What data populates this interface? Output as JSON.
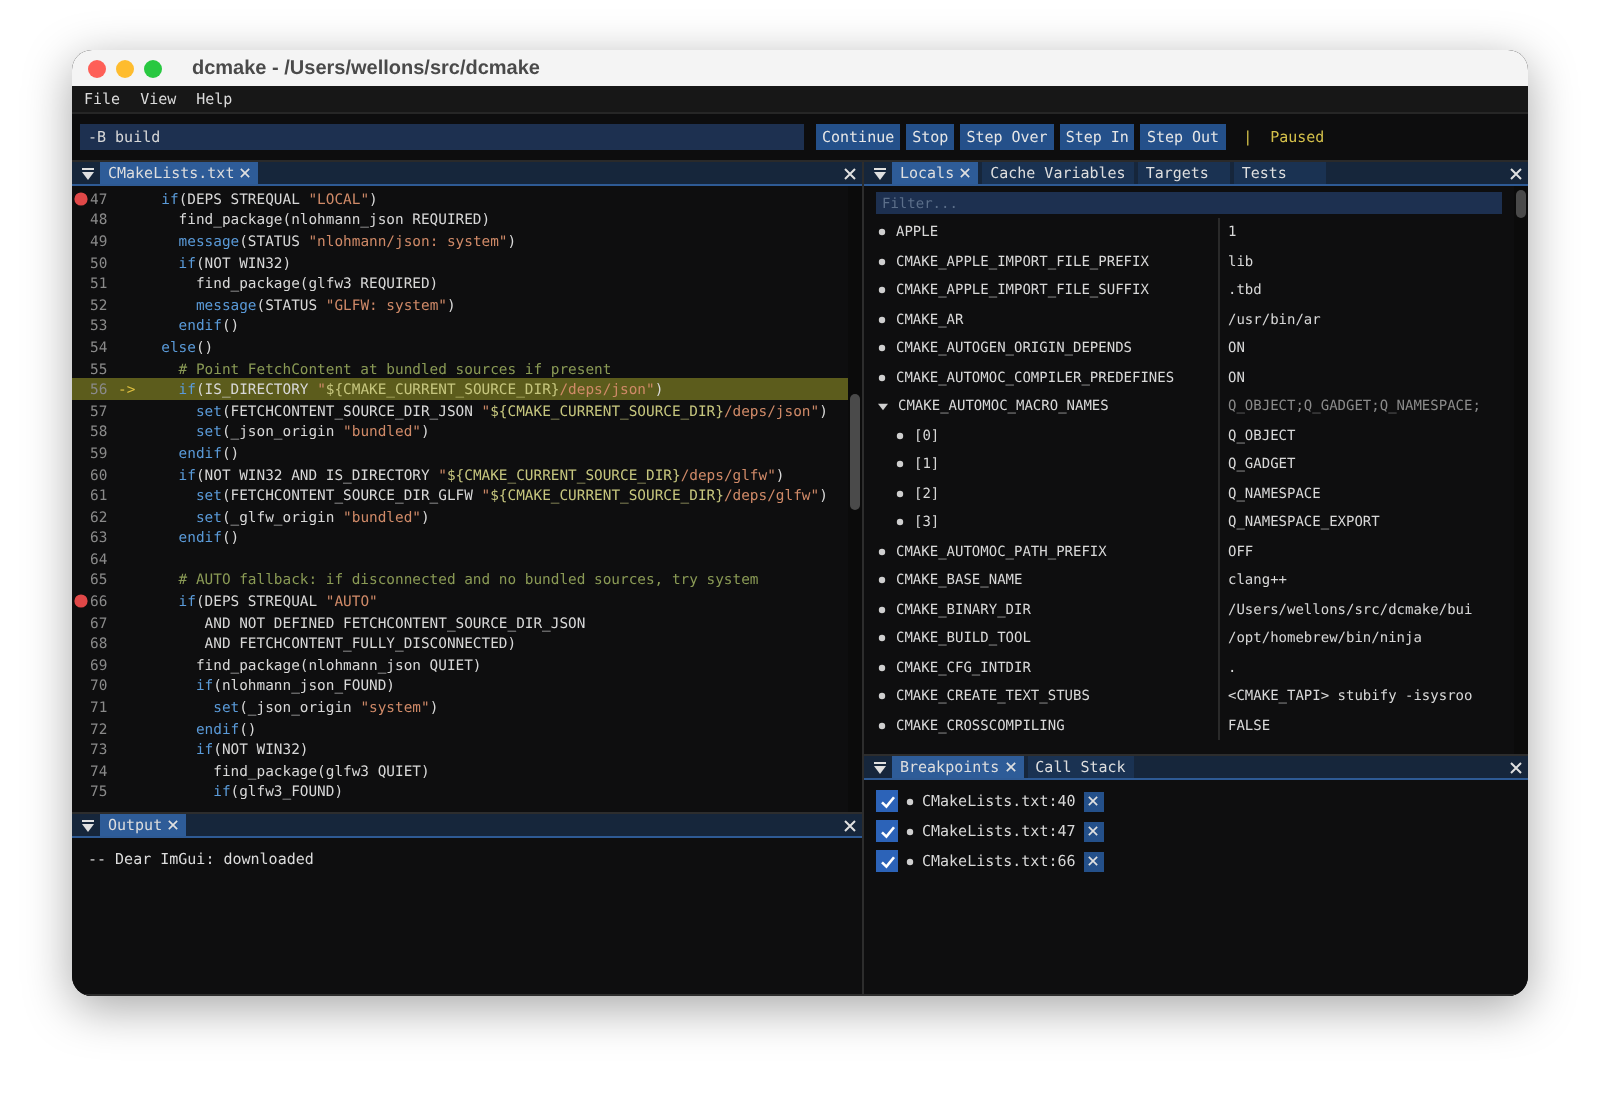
{
  "window": {
    "title": "dcmake - /Users/wellons/src/dcmake"
  },
  "menu": [
    "File",
    "View",
    "Help"
  ],
  "toolbar": {
    "args": "-B build",
    "buttons": [
      "Continue",
      "Stop",
      "Step Over",
      "Step In",
      "Step Out"
    ],
    "separator": "|",
    "status": "Paused"
  },
  "editor": {
    "tabs": [
      {
        "label": "CMakeLists.txt",
        "selected": true
      }
    ],
    "lines": [
      {
        "number": "47",
        "breakpoint": true,
        "current": false,
        "tokens": [
          {
            "kind": "kw",
            "text": "  if"
          },
          {
            "kind": "plain",
            "text": "(DEPS STREQUAL "
          },
          {
            "kind": "str",
            "text": "\"LOCAL\""
          },
          {
            "kind": "plain",
            "text": ")"
          }
        ]
      },
      {
        "number": "48",
        "breakpoint": false,
        "current": false,
        "tokens": [
          {
            "kind": "plain",
            "text": "    find_package(nlohmann_json REQUIRED)"
          }
        ]
      },
      {
        "number": "49",
        "breakpoint": false,
        "current": false,
        "tokens": [
          {
            "kind": "kw",
            "text": "    message"
          },
          {
            "kind": "plain",
            "text": "(STATUS "
          },
          {
            "kind": "str",
            "text": "\"nlohmann/json: system\""
          },
          {
            "kind": "plain",
            "text": ")"
          }
        ]
      },
      {
        "number": "50",
        "breakpoint": false,
        "current": false,
        "tokens": [
          {
            "kind": "kw",
            "text": "    if"
          },
          {
            "kind": "plain",
            "text": "(NOT WIN32)"
          }
        ]
      },
      {
        "number": "51",
        "breakpoint": false,
        "current": false,
        "tokens": [
          {
            "kind": "plain",
            "text": "      find_package(glfw3 REQUIRED)"
          }
        ]
      },
      {
        "number": "52",
        "breakpoint": false,
        "current": false,
        "tokens": [
          {
            "kind": "kw",
            "text": "      message"
          },
          {
            "kind": "plain",
            "text": "(STATUS "
          },
          {
            "kind": "str",
            "text": "\"GLFW: system\""
          },
          {
            "kind": "plain",
            "text": ")"
          }
        ]
      },
      {
        "number": "53",
        "breakpoint": false,
        "current": false,
        "tokens": [
          {
            "kind": "kw",
            "text": "    endif"
          },
          {
            "kind": "plain",
            "text": "()"
          }
        ]
      },
      {
        "number": "54",
        "breakpoint": false,
        "current": false,
        "tokens": [
          {
            "kind": "kw",
            "text": "  else"
          },
          {
            "kind": "plain",
            "text": "()"
          }
        ]
      },
      {
        "number": "55",
        "breakpoint": false,
        "current": false,
        "tokens": [
          {
            "kind": "comment",
            "text": "    # Point FetchContent at bundled sources if present"
          }
        ]
      },
      {
        "number": "56",
        "breakpoint": false,
        "current": true,
        "arrow": "->",
        "tokens": [
          {
            "kind": "kw",
            "text": "    if"
          },
          {
            "kind": "plain",
            "text": "(IS_DIRECTORY "
          },
          {
            "kind": "str",
            "text": "\""
          },
          {
            "kind": "var",
            "text": "${CMAKE_CURRENT_SOURCE_DIR}"
          },
          {
            "kind": "str",
            "text": "/deps/json\""
          },
          {
            "kind": "plain",
            "text": ")"
          }
        ]
      },
      {
        "number": "57",
        "breakpoint": false,
        "current": false,
        "tokens": [
          {
            "kind": "kw",
            "text": "      set"
          },
          {
            "kind": "plain",
            "text": "(FETCHCONTENT_SOURCE_DIR_JSON "
          },
          {
            "kind": "str",
            "text": "\""
          },
          {
            "kind": "var",
            "text": "${CMAKE_CURRENT_SOURCE_DIR}"
          },
          {
            "kind": "str",
            "text": "/deps/json\""
          },
          {
            "kind": "plain",
            "text": ")"
          }
        ]
      },
      {
        "number": "58",
        "breakpoint": false,
        "current": false,
        "tokens": [
          {
            "kind": "kw",
            "text": "      set"
          },
          {
            "kind": "plain",
            "text": "(_json_origin "
          },
          {
            "kind": "str",
            "text": "\"bundled\""
          },
          {
            "kind": "plain",
            "text": ")"
          }
        ]
      },
      {
        "number": "59",
        "breakpoint": false,
        "current": false,
        "tokens": [
          {
            "kind": "kw",
            "text": "    endif"
          },
          {
            "kind": "plain",
            "text": "()"
          }
        ]
      },
      {
        "number": "60",
        "breakpoint": false,
        "current": false,
        "tokens": [
          {
            "kind": "kw",
            "text": "    if"
          },
          {
            "kind": "plain",
            "text": "(NOT WIN32 AND IS_DIRECTORY "
          },
          {
            "kind": "str",
            "text": "\""
          },
          {
            "kind": "var",
            "text": "${CMAKE_CURRENT_SOURCE_DIR}"
          },
          {
            "kind": "str",
            "text": "/deps/glfw\""
          },
          {
            "kind": "plain",
            "text": ")"
          }
        ]
      },
      {
        "number": "61",
        "breakpoint": false,
        "current": false,
        "tokens": [
          {
            "kind": "kw",
            "text": "      set"
          },
          {
            "kind": "plain",
            "text": "(FETCHCONTENT_SOURCE_DIR_GLFW "
          },
          {
            "kind": "str",
            "text": "\""
          },
          {
            "kind": "var",
            "text": "${CMAKE_CURRENT_SOURCE_DIR}"
          },
          {
            "kind": "str",
            "text": "/deps/glfw\""
          },
          {
            "kind": "plain",
            "text": ")"
          }
        ]
      },
      {
        "number": "62",
        "breakpoint": false,
        "current": false,
        "tokens": [
          {
            "kind": "kw",
            "text": "      set"
          },
          {
            "kind": "plain",
            "text": "(_glfw_origin "
          },
          {
            "kind": "str",
            "text": "\"bundled\""
          },
          {
            "kind": "plain",
            "text": ")"
          }
        ]
      },
      {
        "number": "63",
        "breakpoint": false,
        "current": false,
        "tokens": [
          {
            "kind": "kw",
            "text": "    endif"
          },
          {
            "kind": "plain",
            "text": "()"
          }
        ]
      },
      {
        "number": "64",
        "breakpoint": false,
        "current": false
      },
      {
        "number": "65",
        "breakpoint": false,
        "current": false,
        "tokens": [
          {
            "kind": "comment",
            "text": "    # AUTO fallback: if disconnected and no bundled sources, try system"
          }
        ]
      },
      {
        "number": "66",
        "breakpoint": true,
        "current": false,
        "tokens": [
          {
            "kind": "kw",
            "text": "    if"
          },
          {
            "kind": "plain",
            "text": "(DEPS STREQUAL "
          },
          {
            "kind": "str",
            "text": "\"AUTO\""
          }
        ]
      },
      {
        "number": "67",
        "breakpoint": false,
        "current": false,
        "tokens": [
          {
            "kind": "plain",
            "text": "       AND NOT DEFINED FETCHCONTENT_SOURCE_DIR_JSON"
          }
        ]
      },
      {
        "number": "68",
        "breakpoint": false,
        "current": false,
        "tokens": [
          {
            "kind": "plain",
            "text": "       AND FETCHCONTENT_FULLY_DISCONNECTED)"
          }
        ]
      },
      {
        "number": "69",
        "breakpoint": false,
        "current": false,
        "tokens": [
          {
            "kind": "plain",
            "text": "      find_package(nlohmann_json QUIET)"
          }
        ]
      },
      {
        "number": "70",
        "breakpoint": false,
        "current": false,
        "tokens": [
          {
            "kind": "kw",
            "text": "      if"
          },
          {
            "kind": "plain",
            "text": "(nlohmann_json_FOUND)"
          }
        ]
      },
      {
        "number": "71",
        "breakpoint": false,
        "current": false,
        "tokens": [
          {
            "kind": "kw",
            "text": "        set"
          },
          {
            "kind": "plain",
            "text": "(_json_origin "
          },
          {
            "kind": "str",
            "text": "\"system\""
          },
          {
            "kind": "plain",
            "text": ")"
          }
        ]
      },
      {
        "number": "72",
        "breakpoint": false,
        "current": false,
        "tokens": [
          {
            "kind": "kw",
            "text": "      endif"
          },
          {
            "kind": "plain",
            "text": "()"
          }
        ]
      },
      {
        "number": "73",
        "breakpoint": false,
        "current": false,
        "tokens": [
          {
            "kind": "kw",
            "text": "      if"
          },
          {
            "kind": "plain",
            "text": "(NOT WIN32)"
          }
        ]
      },
      {
        "number": "74",
        "breakpoint": false,
        "current": false,
        "tokens": [
          {
            "kind": "plain",
            "text": "        find_package(glfw3 QUIET)"
          }
        ]
      },
      {
        "number": "75",
        "breakpoint": false,
        "current": false,
        "tokens": [
          {
            "kind": "kw",
            "text": "        if"
          },
          {
            "kind": "plain",
            "text": "(glfw3_FOUND)"
          }
        ]
      }
    ]
  },
  "output": {
    "tabs": [
      {
        "label": "Output",
        "selected": true
      }
    ],
    "lines": [
      "-- Dear ImGui: downloaded"
    ]
  },
  "locals": {
    "tabs": [
      {
        "label": "Locals",
        "selected": true
      },
      {
        "label": "Cache Variables",
        "selected": false
      },
      {
        "label": "Targets",
        "selected": false
      },
      {
        "label": "Tests",
        "selected": false
      }
    ],
    "filter": {
      "placeholder": "Filter..."
    },
    "rows": [
      {
        "name": "APPLE",
        "value": "1"
      },
      {
        "name": "CMAKE_APPLE_IMPORT_FILE_PREFIX",
        "value": "lib"
      },
      {
        "name": "CMAKE_APPLE_IMPORT_FILE_SUFFIX",
        "value": ".tbd"
      },
      {
        "name": "CMAKE_AR",
        "value": "/usr/bin/ar"
      },
      {
        "name": "CMAKE_AUTOGEN_ORIGIN_DEPENDS",
        "value": "ON"
      },
      {
        "name": "CMAKE_AUTOMOC_COMPILER_PREDEFINES",
        "value": "ON"
      },
      {
        "name": "CMAKE_AUTOMOC_MACRO_NAMES",
        "value": "Q_OBJECT;Q_GADGET;Q_NAMESPACE;",
        "expanded": true,
        "children": [
          {
            "name": "[0]",
            "value": "Q_OBJECT"
          },
          {
            "name": "[1]",
            "value": "Q_GADGET"
          },
          {
            "name": "[2]",
            "value": "Q_NAMESPACE"
          },
          {
            "name": "[3]",
            "value": "Q_NAMESPACE_EXPORT"
          }
        ]
      },
      {
        "name": "CMAKE_AUTOMOC_PATH_PREFIX",
        "value": "OFF"
      },
      {
        "name": "CMAKE_BASE_NAME",
        "value": "clang++"
      },
      {
        "name": "CMAKE_BINARY_DIR",
        "value": "/Users/wellons/src/dcmake/bui"
      },
      {
        "name": "CMAKE_BUILD_TOOL",
        "value": "/opt/homebrew/bin/ninja"
      },
      {
        "name": "CMAKE_CFG_INTDIR",
        "value": "."
      },
      {
        "name": "CMAKE_CREATE_TEXT_STUBS",
        "value": "<CMAKE_TAPI> stubify -isysroo"
      },
      {
        "name": "CMAKE_CROSSCOMPILING",
        "value": "FALSE"
      }
    ]
  },
  "breakpoints": {
    "tabs": [
      {
        "label": "Breakpoints",
        "selected": true
      },
      {
        "label": "Call Stack",
        "selected": false
      }
    ],
    "items": [
      {
        "label": "CMakeLists.txt:40",
        "checked": true
      },
      {
        "label": "CMakeLists.txt:47",
        "checked": true
      },
      {
        "label": "CMakeLists.txt:66",
        "checked": true
      }
    ]
  }
}
